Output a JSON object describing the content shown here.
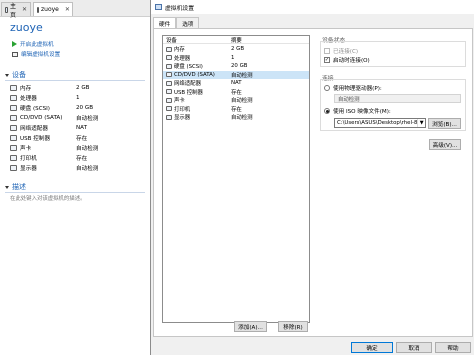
{
  "left": {
    "tabs": [
      {
        "label": "主页"
      },
      {
        "label": "zuoye"
      }
    ],
    "vm_title": "zuoye",
    "actions": {
      "power_on": "开启此虚拟机",
      "edit_settings": "编辑虚拟机设置"
    },
    "devices_section": "设备",
    "devices": [
      {
        "name": "内存",
        "value": "2 GB",
        "icon": "memory-icon"
      },
      {
        "name": "处理器",
        "value": "1",
        "icon": "cpu-icon"
      },
      {
        "name": "硬盘 (SCSI)",
        "value": "20 GB",
        "icon": "hard-disk-icon"
      },
      {
        "name": "CD/DVD (SATA)",
        "value": "自动检测",
        "icon": "cd-dvd-icon"
      },
      {
        "name": "网络适配器",
        "value": "NAT",
        "icon": "network-icon"
      },
      {
        "name": "USB 控制器",
        "value": "存在",
        "icon": "usb-icon"
      },
      {
        "name": "声卡",
        "value": "自动检测",
        "icon": "sound-card-icon"
      },
      {
        "name": "打印机",
        "value": "存在",
        "icon": "printer-icon"
      },
      {
        "name": "显示器",
        "value": "自动检测",
        "icon": "display-icon"
      }
    ],
    "description_section": "描述",
    "description_placeholder": "在此处键入对该虚拟机的描述。"
  },
  "dialog": {
    "title": "虚拟机设置",
    "tabs": [
      {
        "label": "硬件"
      },
      {
        "label": "选项"
      }
    ],
    "hardware_table": {
      "col_device": "设备",
      "col_summary": "摘要",
      "selected_index": 3,
      "rows": [
        {
          "device": "内存",
          "summary": "2 GB"
        },
        {
          "device": "处理器",
          "summary": "1"
        },
        {
          "device": "硬盘 (SCSI)",
          "summary": "20 GB"
        },
        {
          "device": "CD/DVD (SATA)",
          "summary": "自动检测"
        },
        {
          "device": "网络适配器",
          "summary": "NAT"
        },
        {
          "device": "USB 控制器",
          "summary": "存在"
        },
        {
          "device": "声卡",
          "summary": "自动检测"
        },
        {
          "device": "打印机",
          "summary": "存在"
        },
        {
          "device": "显示器",
          "summary": "自动检测"
        }
      ]
    },
    "add_button": "添加(A)...",
    "remove_button": "移除(R)",
    "device_status": {
      "title": "设备状态",
      "connected": {
        "label": "已连接(C)",
        "checked": false,
        "enabled": false
      },
      "connect_at_power_on": {
        "label": "启动时连接(O)",
        "checked": true,
        "enabled": true
      }
    },
    "connection": {
      "title": "连接",
      "use_physical": {
        "label": "使用物理驱动器(P):",
        "selected": false
      },
      "physical_value": "自动检测",
      "use_iso": {
        "label": "使用 ISO 映像文件(M):",
        "selected": true
      },
      "iso_path": "C:\\Users\\ASUS\\Desktop\\rhel-8",
      "browse_button": "浏览(B)..."
    },
    "advanced_button": "高级(V)...",
    "footer": {
      "ok": "确定",
      "cancel": "取消",
      "help": "帮助"
    }
  }
}
